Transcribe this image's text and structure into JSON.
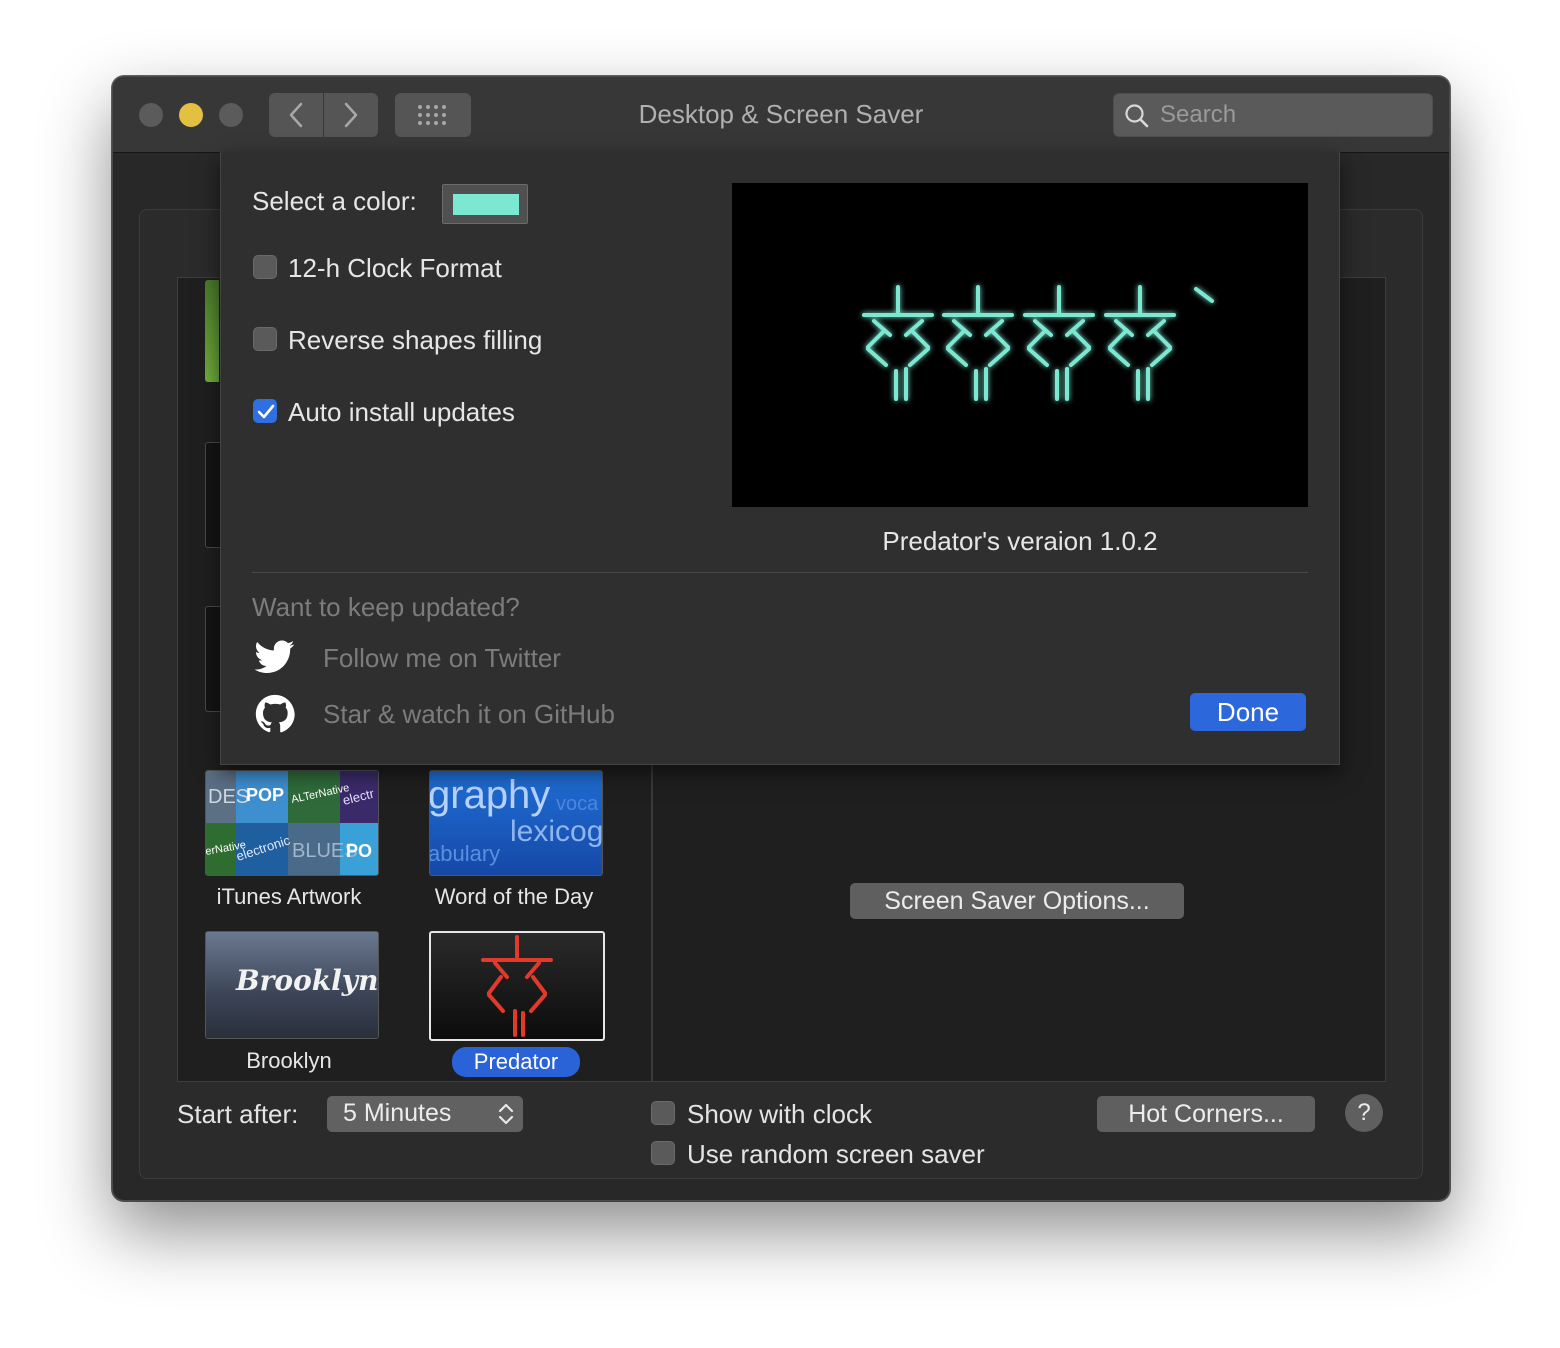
{
  "window": {
    "title": "Desktop & Screen Saver"
  },
  "search": {
    "placeholder": "Search",
    "value": ""
  },
  "sheet": {
    "color_label": "Select a color:",
    "color_value": "#7de8d2",
    "options": [
      {
        "label": "12-h Clock Format",
        "checked": false
      },
      {
        "label": "Reverse shapes filling",
        "checked": false
      },
      {
        "label": "Auto install updates",
        "checked": true
      }
    ],
    "version_text": "Predator's veraion  1.0.2",
    "updates_heading": "Want to keep updated?",
    "twitter_link": "Follow me on Twitter",
    "github_link": "Star & watch it on GitHub",
    "done_label": "Done"
  },
  "savers": [
    {
      "name": "iTunes Artwork",
      "selected": false
    },
    {
      "name": "Word of the Day",
      "selected": false
    },
    {
      "name": "Brooklyn",
      "selected": false
    },
    {
      "name": "Predator",
      "selected": true
    }
  ],
  "word_tile_text": {
    "line1": "graphy",
    "line1b": "voca",
    "line2": "lexicog",
    "line3": "abulary"
  },
  "itunes_tile_text": [
    "DES",
    "POP",
    "ALTerNative",
    "electr",
    "erNative",
    "electronic",
    "BLUES",
    "PO"
  ],
  "brooklyn_tile_text": "Brooklyn",
  "screen_saver_options_label": "Screen Saver Options...",
  "bottom": {
    "start_after_label": "Start after:",
    "start_after_value": "5 Minutes",
    "show_with_clock": {
      "label": "Show with clock",
      "checked": false
    },
    "random_saver": {
      "label": "Use random screen saver",
      "checked": false
    },
    "hot_corners_label": "Hot Corners...",
    "help_label": "?"
  },
  "colors": {
    "accent": "#2c67dc",
    "predator_glow": "#7de8d2",
    "predator_red": "#e23a2a"
  }
}
